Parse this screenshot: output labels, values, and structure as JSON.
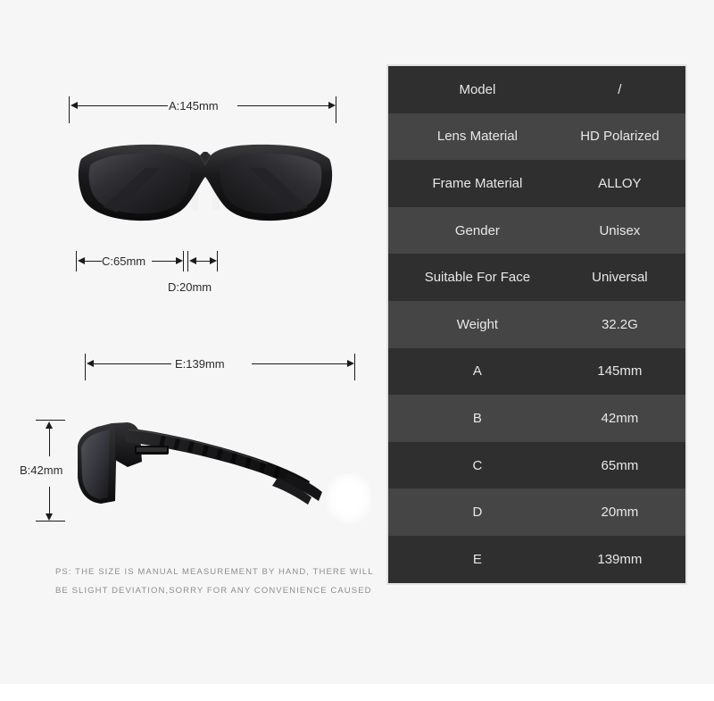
{
  "product": {
    "type": "sunglasses",
    "views": [
      "front-view",
      "side-view"
    ]
  },
  "dimensions": {
    "a": {
      "label": "A:145mm",
      "value": "145mm",
      "letter": "A"
    },
    "b": {
      "label": "B:42mm",
      "value": "42mm",
      "letter": "B"
    },
    "c": {
      "label": "C:65mm",
      "value": "65mm",
      "letter": "C"
    },
    "d": {
      "label": "D:20mm",
      "value": "20mm",
      "letter": "D"
    },
    "e": {
      "label": "E:139mm",
      "value": "139mm",
      "letter": "E"
    }
  },
  "disclaimer": {
    "line1": "PS: THE SIZE IS MANUAL MEASUREMENT BY HAND, THERE WILL",
    "line2": "BE SLIGHT DEVIATION,SORRY FOR ANY CONVENIENCE CAUSED"
  },
  "spec_table": {
    "rows": [
      {
        "key": "Model",
        "value": "/"
      },
      {
        "key": "Lens Material",
        "value": "HD Polarized"
      },
      {
        "key": "Frame Material",
        "value": "ALLOY"
      },
      {
        "key": "Gender",
        "value": "Unisex"
      },
      {
        "key": "Suitable For Face",
        "value": "Universal"
      },
      {
        "key": "Weight",
        "value": "32.2G"
      },
      {
        "key": "A",
        "value": "145mm"
      },
      {
        "key": "B",
        "value": "42mm"
      },
      {
        "key": "C",
        "value": "65mm"
      },
      {
        "key": "D",
        "value": "20mm"
      },
      {
        "key": "E",
        "value": "139mm"
      }
    ]
  },
  "colors": {
    "background": "#f6f6f6",
    "row_dark": "#2f2f2f",
    "row_light": "#454545",
    "text_light": "#e8e8e8",
    "dim_line": "#1b1b1b",
    "note_text": "#8d8d8d"
  }
}
